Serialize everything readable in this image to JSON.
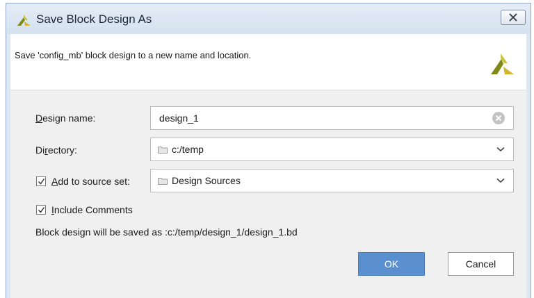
{
  "dialog": {
    "title": "Save Block Design As",
    "close_icon": "close-icon",
    "logo_icon": "vivado-logo-icon"
  },
  "header": {
    "description": "Save 'config_mb' block design to a new name and location."
  },
  "form": {
    "design_name": {
      "label_mnemonic": "D",
      "label_rest": "esign name:",
      "value": "design_1"
    },
    "directory": {
      "label_pre": "Di",
      "label_mnemonic": "r",
      "label_rest": "ectory:",
      "value": "c:/temp"
    },
    "source_set": {
      "checked": true,
      "label_mnemonic": "A",
      "label_rest": "dd to source set:",
      "value": "Design Sources"
    },
    "include_comments": {
      "checked": true,
      "label_mnemonic": "I",
      "label_rest": "nclude Comments"
    },
    "save_path_info": "Block design will be saved as :c:/temp/design_1/design_1.bd"
  },
  "buttons": {
    "ok": "OK",
    "cancel": "Cancel"
  },
  "colors": {
    "accent": "#5a8fd0",
    "title_bar": "#dce7f3"
  }
}
